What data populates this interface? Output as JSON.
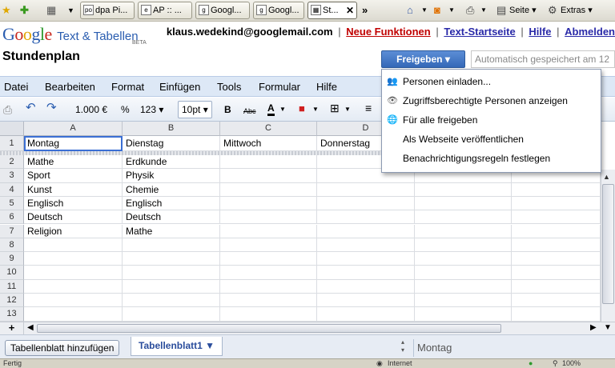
{
  "browser": {
    "tabs": [
      {
        "label": "dpa Pi..."
      },
      {
        "label": "AP :: ..."
      },
      {
        "label": "Googl..."
      },
      {
        "label": "Googl..."
      },
      {
        "label": "St..."
      }
    ],
    "tab_overflow": "»",
    "page_label": "Seite",
    "extras_label": "Extras"
  },
  "header": {
    "logo_google": "Google",
    "logo_product": "Text & Tabellen",
    "logo_beta": "BETA",
    "email": "klaus.wedekind@googlemail.com",
    "links": [
      "Neue Funktionen",
      "Text-Startseite",
      "Hilfe",
      "Abmelden"
    ],
    "doc_title": "Stundenplan",
    "share_label": "Freigeben ▾",
    "autosave_text": "Automatisch gespeichert am 12"
  },
  "menu": [
    "Datei",
    "Bearbeiten",
    "Format",
    "Einfügen",
    "Tools",
    "Formular",
    "Hilfe"
  ],
  "toolbar": {
    "currency": "1.000 €",
    "percent": "%",
    "number_format": "123 ▾",
    "font_size": "10pt ▾",
    "bold": "B",
    "strike": "Abc",
    "text_color": "A"
  },
  "grid": {
    "columns": [
      "A",
      "B",
      "C",
      "D"
    ],
    "row_numbers": [
      "1",
      "2",
      "3",
      "4",
      "5",
      "6",
      "7",
      "8",
      "9",
      "10",
      "11",
      "12",
      "13"
    ],
    "header_row": [
      "Montag",
      "Dienstag",
      "Mittwoch",
      "Donnerstag"
    ],
    "rows": [
      [
        "Mathe",
        "Erdkunde"
      ],
      [
        "Sport",
        "Physik"
      ],
      [
        "Kunst",
        "Chemie"
      ],
      [
        "Englisch",
        "Englisch"
      ],
      [
        "Deutsch",
        "Deutsch"
      ],
      [
        "Religion",
        "Mathe"
      ]
    ]
  },
  "share_menu": {
    "items": [
      {
        "label": "Personen einladen...",
        "icon": "people-icon"
      },
      {
        "label": "Zugriffsberechtigte Personen anzeigen",
        "icon": "eye-icon"
      },
      {
        "label": "Für alle freigeben",
        "icon": "globe-icon"
      },
      {
        "label": "Als Webseite veröffentlichen",
        "icon": ""
      },
      {
        "label": "Benachrichtigungsregeln festlegen",
        "icon": ""
      }
    ]
  },
  "sheets": {
    "add_label": "Tabellenblatt hinzufügen",
    "active_tab": "Tabellenblatt1 ▼",
    "cell_preview": "Montag"
  },
  "status": {
    "left_text": "Fertig",
    "zone_text": "Internet",
    "zoom": "100%"
  }
}
